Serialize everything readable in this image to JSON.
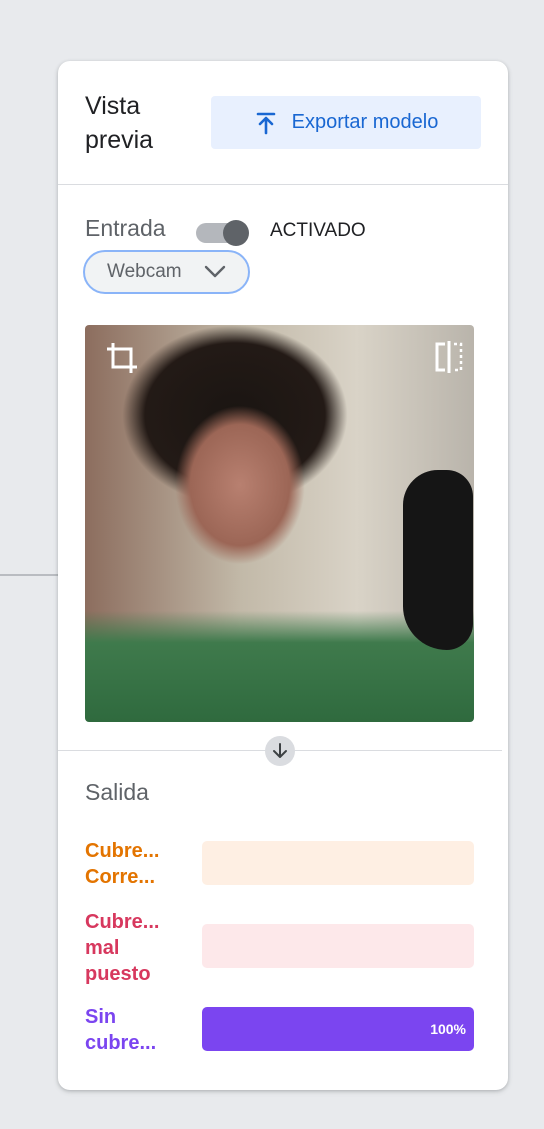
{
  "header": {
    "title": "Vista previa",
    "export_label": "Exportar modelo"
  },
  "input": {
    "label": "Entrada",
    "toggle_state": "ACTIVADO",
    "toggle_on": true,
    "source": "Webcam"
  },
  "icons": {
    "export": "upload-icon",
    "dropdown": "chevron-down-icon",
    "crop": "crop-icon",
    "flip": "flip-horizontal-icon",
    "divider": "arrow-down-icon"
  },
  "output": {
    "label": "Salida",
    "classes": [
      {
        "name": "Cubre...\nCorre...",
        "confidence": 0.0,
        "percent_label": "",
        "color": "#e37400",
        "bar_bg": "#feefe3"
      },
      {
        "name": "Cubre...\nmal\npuesto",
        "confidence": 0.0,
        "percent_label": "",
        "color": "#d7385e",
        "bar_bg": "#fde8ea"
      },
      {
        "name": "Sin\ncubre...",
        "confidence": 1.0,
        "percent_label": "100%",
        "color": "#7b45f0",
        "bar_bg": "#e9e1fd"
      }
    ]
  },
  "colors": {
    "accent": "#1967d2",
    "accent_bg": "#e8f0fe",
    "focus_outline": "#8ab4f8"
  }
}
